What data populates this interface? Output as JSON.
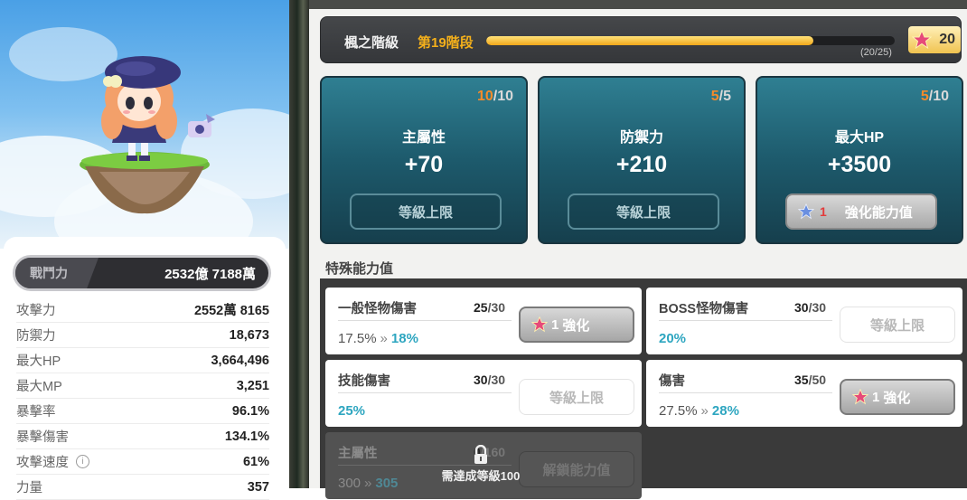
{
  "character": {
    "combat_power_label": "戰鬥力",
    "combat_power_value": "2532億 7188萬"
  },
  "stats": [
    {
      "name": "攻擊力",
      "value": "2552萬 8165"
    },
    {
      "name": "防禦力",
      "value": "18,673"
    },
    {
      "name": "最大HP",
      "value": "3,664,496"
    },
    {
      "name": "最大MP",
      "value": "3,251"
    },
    {
      "name": "暴擊率",
      "value": "96.1%"
    },
    {
      "name": "暴擊傷害",
      "value": "134.1%"
    },
    {
      "name": "攻擊速度",
      "value": "61%",
      "info": "i"
    },
    {
      "name": "力量",
      "value": "357"
    }
  ],
  "maple_level": {
    "title": "楓之階級",
    "stage": "第19階段",
    "progress_text": "(20/25)",
    "progress_fraction": 0.8,
    "badge_value": "20"
  },
  "main_cards": [
    {
      "current": "10",
      "max": "/10",
      "name": "主屬性",
      "value": "+70",
      "button": "等級上限",
      "active": false
    },
    {
      "current": "5",
      "max": "/5",
      "name": "防禦力",
      "value": "+210",
      "button": "等級上限",
      "active": false
    },
    {
      "current": "5",
      "max": "/10",
      "name": "最大HP",
      "value": "+3500",
      "button": "強化能力值",
      "active": true,
      "cost": "1"
    }
  ],
  "special_title": "特殊能力值",
  "special": [
    {
      "name": "一般怪物傷害",
      "current": "25",
      "max": "/30",
      "from": "17.5%",
      "arrow": "»",
      "to": "18%",
      "button": "強化",
      "active": true,
      "cost": "1"
    },
    {
      "name": "BOSS怪物傷害",
      "current": "30",
      "max": "/30",
      "from": "",
      "arrow": "",
      "to": "20%",
      "button": "等級上限",
      "active": false
    },
    {
      "name": "技能傷害",
      "current": "30",
      "max": "/30",
      "from": "",
      "arrow": "",
      "to": "25%",
      "button": "等級上限",
      "active": false
    },
    {
      "name": "傷害",
      "current": "35",
      "max": "/50",
      "from": "27.5%",
      "arrow": "»",
      "to": "28%",
      "button": "強化",
      "active": true,
      "cost": "1"
    },
    {
      "name": "主屬性",
      "current": "0",
      "max": "/160",
      "from": "300",
      "arrow": "»",
      "to": "305",
      "button": "解鎖能力值",
      "active": false,
      "locked": true
    }
  ],
  "lock_message": "需達成等級100",
  "colors": {
    "accent_orange": "#f58b2a",
    "gold": "#f4b01b",
    "teal_card": "#1d5a6c",
    "cyan_value": "#2ea6c0",
    "cost_red": "#e23b3b"
  }
}
